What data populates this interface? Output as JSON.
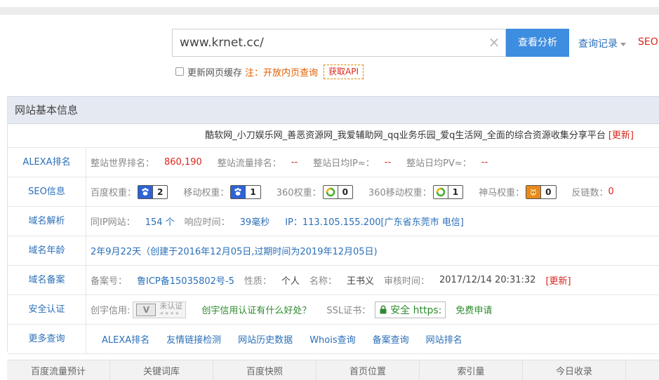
{
  "search": {
    "value": "www.krnet.cc/",
    "clear_icon": "×",
    "analyze_label": "查看分析",
    "history_label": "查询记录",
    "seo_label": "SEO"
  },
  "options": {
    "update_cache_label": "更新网页缓存",
    "note": "注：开放内页查询",
    "api_label": "获取API"
  },
  "panel": {
    "title": "网站基本信息",
    "site_title": "酷软网_小刀娱乐网_善恶资源网_我爱辅助网_qq业务乐园_爱q生活网_全面的综合资源收集分享平台",
    "update_label": "[更新]"
  },
  "alexa": {
    "key": "ALEXA排名",
    "world_label": "整站世界排名：",
    "world_value": "860,190",
    "traffic_label": "整站流量排名：",
    "traffic_value": "--",
    "ip_label": "整站日均IP≈：",
    "ip_value": "--",
    "pv_label": "整站日均PV≈：",
    "pv_value": "--"
  },
  "seo": {
    "key": "SEO信息",
    "baidu_label": "百度权重：",
    "baidu_value": "2",
    "mobile_label": "移动权重：",
    "mobile_value": "1",
    "w360_label": "360权重：",
    "w360_value": "0",
    "m360_label": "360移动权重：",
    "m360_value": "1",
    "shenma_label": "神马权重：",
    "shenma_value": "0",
    "backlink_label": "反链数：",
    "backlink_value": "0"
  },
  "dns": {
    "key": "域名解析",
    "sameip_label": "同IP网站：",
    "sameip_value": "154 个",
    "resp_label": "响应时间：",
    "resp_value": "39毫秒",
    "ip_value": "IP：113.105.155.200[广东省东莞市 电信]"
  },
  "age": {
    "key": "域名年龄",
    "value": "2年9月22天（创建于2016年12月05日,过期时间为2019年12月05日)"
  },
  "icp": {
    "key": "域名备案",
    "no_label": "备案号：",
    "no_value": "鲁ICP备15035802号-5",
    "type_label": "性质：",
    "type_value": "个人",
    "name_label": "名称：",
    "name_value": "王书义",
    "time_label": "审核时间：",
    "time_value": "2017/12/14 20:31:32",
    "update_label": "[更新]"
  },
  "security": {
    "key": "安全认证",
    "credit_label": "创宇信用:",
    "cert_text": "未认证",
    "cert_stars": "★★★★",
    "credit_link": "创宇信用认证有什么好处？",
    "ssl_label": "SSL证书：",
    "https_label": "安全 https:",
    "free_apply": "免费申请"
  },
  "more": {
    "key": "更多查询",
    "links": [
      "ALEXA排名",
      "友情链接检测",
      "网站历史数据",
      "Whois查询",
      "备案查询",
      "网站排名"
    ]
  },
  "tabs": [
    "百度流量预计",
    "关键词库",
    "百度快照",
    "首页位置",
    "索引量",
    "今日收录"
  ]
}
